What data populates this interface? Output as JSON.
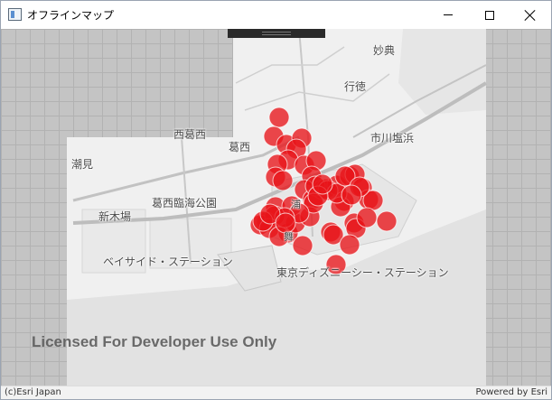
{
  "window": {
    "title": "オフラインマップ",
    "minimize_icon": "minimize-icon",
    "maximize_icon": "maximize-icon",
    "close_icon": "close-icon"
  },
  "map": {
    "place_labels": {
      "myoten": "妙典",
      "gyotoku": "行徳",
      "nishikasai": "西葛西",
      "kasai": "葛西",
      "ichikawashiohama": "市川塩浜",
      "shiomi": "潮見",
      "kasairinkaikoen": "葛西臨海公園",
      "shinkiba": "新木場",
      "urayasu": "浦",
      "maihama": "舞",
      "bayside": "ベイサイド・ステーション",
      "tds": "東京ディズニーシー・ステーション"
    },
    "marker_color": "#e8141a",
    "point_count": 57,
    "watermark": "Licensed For Developer Use Only"
  },
  "attribution": {
    "left": "(c)Esri Japan",
    "right": "Powered by Esri"
  }
}
